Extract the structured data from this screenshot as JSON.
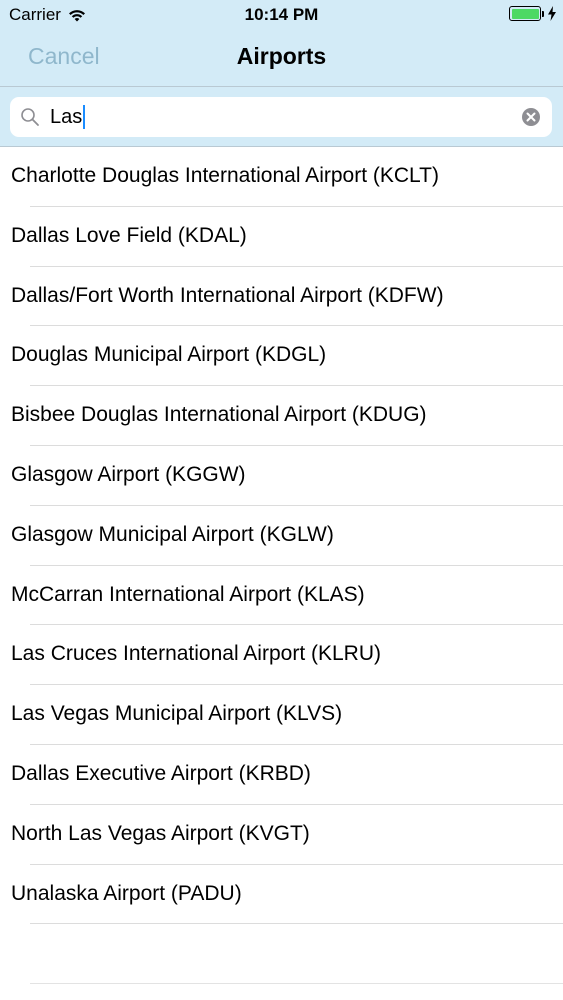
{
  "status_bar": {
    "carrier": "Carrier",
    "time": "10:14 PM",
    "battery_color": "#4cd964"
  },
  "nav": {
    "cancel_label": "Cancel",
    "title": "Airports"
  },
  "search": {
    "value": "Las",
    "icon": "search-icon",
    "clear_icon": "clear-icon"
  },
  "airports": [
    {
      "label": "Charlotte Douglas International Airport (KCLT)"
    },
    {
      "label": "Dallas Love Field (KDAL)"
    },
    {
      "label": "Dallas/Fort Worth International Airport (KDFW)"
    },
    {
      "label": "Douglas Municipal Airport (KDGL)"
    },
    {
      "label": "Bisbee Douglas International Airport (KDUG)"
    },
    {
      "label": "Glasgow Airport (KGGW)"
    },
    {
      "label": "Glasgow Municipal Airport (KGLW)"
    },
    {
      "label": "McCarran International Airport (KLAS)"
    },
    {
      "label": "Las Cruces International Airport (KLRU)"
    },
    {
      "label": "Las Vegas Municipal Airport (KLVS)"
    },
    {
      "label": "Dallas Executive Airport (KRBD)"
    },
    {
      "label": "North Las Vegas Airport (KVGT)"
    },
    {
      "label": "Unalaska Airport (PADU)"
    }
  ],
  "colors": {
    "header_bg": "#d3ebf7",
    "cancel": "#8fb7cc",
    "caret": "#1a8cff"
  }
}
